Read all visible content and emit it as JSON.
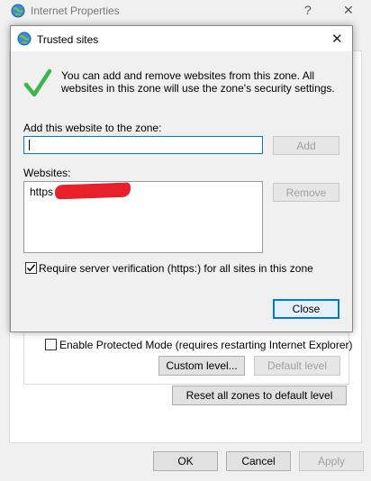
{
  "outer_window": {
    "title": "Internet Properties",
    "help_glyph": "?",
    "close_glyph": "✕",
    "icon": "internet-globe-icon",
    "protected_mode_label": "Enable Protected Mode (requires restarting Internet Explorer)",
    "protected_mode_checked": false,
    "custom_level_label": "Custom level...",
    "default_level_label": "Default level",
    "reset_all_label": "Reset all zones to default level",
    "ok_label": "OK",
    "cancel_label": "Cancel",
    "apply_label": "Apply"
  },
  "dialog": {
    "title": "Trusted sites",
    "icon": "trusted-sites-globe-icon",
    "close_glyph": "✕",
    "info_icon": "green-checkmark-icon",
    "info_text": "You can add and remove websites from this zone. All websites in this zone will use the zone's security settings.",
    "add_label": "Add this website to the zone:",
    "add_input_value": "",
    "add_button_label": "Add",
    "websites_label": "Websites:",
    "websites": [
      "https"
    ],
    "remove_button_label": "Remove",
    "require_https_label": "Require server verification (https:) for all sites in this zone",
    "require_https_checked": true,
    "close_button_label": "Close"
  },
  "colors": {
    "accent": "#0078d7",
    "check_green": "#3ab54a",
    "redaction": "#e8202a"
  }
}
